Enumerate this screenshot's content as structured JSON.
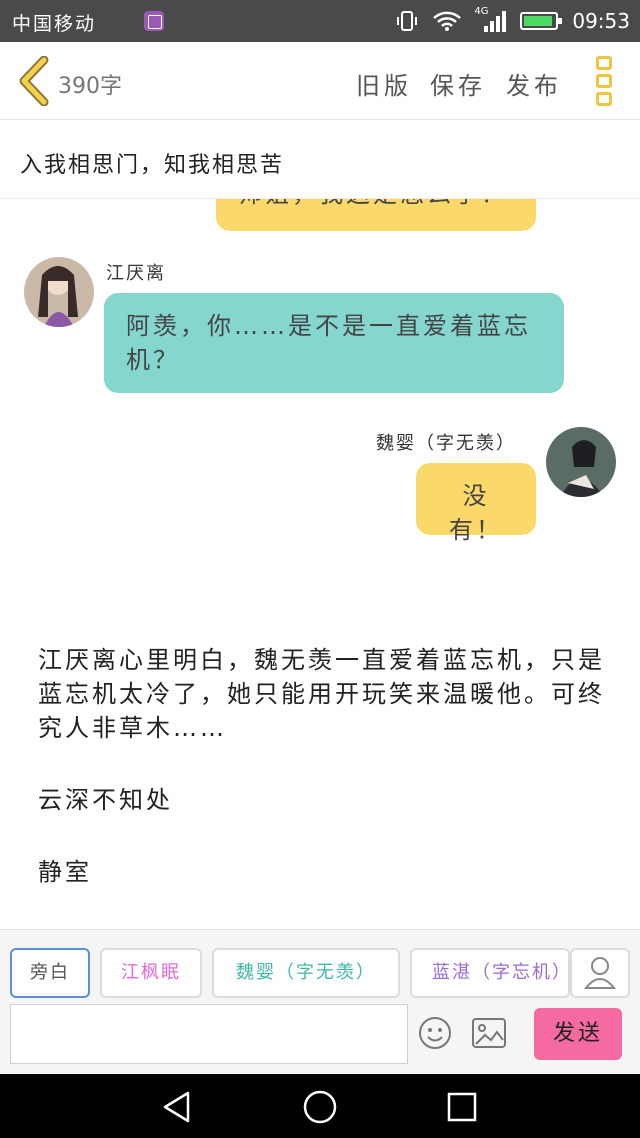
{
  "status_bar": {
    "carrier": "中国移动",
    "network": "4G",
    "time": "09:53"
  },
  "header": {
    "word_count": "390字",
    "old_version": "旧版",
    "save": "保存",
    "publish": "发布"
  },
  "subtitle": "入我相思门，知我相思苦",
  "chat": [
    {
      "side": "right",
      "partial": true,
      "text": "师姐，我这是怎么了？"
    },
    {
      "side": "left",
      "speaker": "江厌离",
      "text": "阿羡，你……是不是一直爱着蓝忘机？"
    },
    {
      "side": "right",
      "speaker": "魏婴（字无羡）",
      "text": "没有！"
    }
  ],
  "narration": [
    "江厌离心里明白，魏无羡一直爱着蓝忘机，只是蓝忘机太冷了，她只能用开玩笑来温暖他。可终究人非草木……",
    "云深不知处",
    "静室"
  ],
  "toolbar": {
    "roles": [
      {
        "label": "旁白",
        "color": "#555555"
      },
      {
        "label": "江枫眠",
        "color": "#e26bd6"
      },
      {
        "label": "魏婴（字无羡）",
        "color": "#3fb8a8"
      },
      {
        "label": "蓝湛（字忘机）",
        "color": "#9a6bd8"
      }
    ],
    "send": "发送"
  },
  "colors": {
    "yellow_bubble": "#fbd86a",
    "teal_bubble": "#86d6d0",
    "send_button": "#f56aa1",
    "menu_accent": "#f0c43c"
  }
}
